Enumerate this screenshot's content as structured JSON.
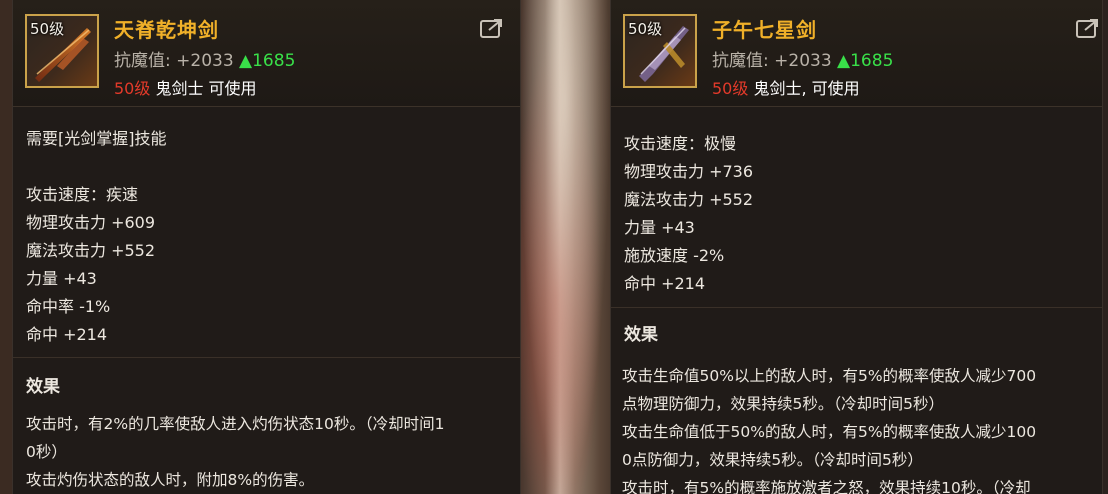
{
  "left": {
    "level_badge": "50级",
    "name": "天脊乾坤剑",
    "resist_label": "抗魔值: +2033",
    "resist_bonus": "▲1685",
    "req_level": "50级",
    "req_class": " 鬼剑士 可使用",
    "requirement": "需要[光剑掌握]技能",
    "stats": [
      "攻击速度：疾速",
      "物理攻击力 +609",
      "魔法攻击力 +552",
      "力量 +43",
      "命中率 -1%",
      "命中 +214"
    ],
    "effect_title": "效果",
    "effects": [
      "攻击时，有2%的几率使敌人进入灼伤状态10秒。（冷却时间1",
      "0秒）",
      "攻击灼伤状态的敌人时，附加8%的伤害。"
    ]
  },
  "right": {
    "level_badge": "50级",
    "name": "子午七星剑",
    "resist_label": "抗魔值: +2033",
    "resist_bonus": "▲1685",
    "req_level": "50级",
    "req_class": " 鬼剑士, 可使用",
    "stats": [
      "攻击速度：极慢",
      "物理攻击力 +736",
      "魔法攻击力 +552",
      "力量 +43",
      "施放速度 -2%",
      "命中 +214"
    ],
    "effect_title": "效果",
    "effects": [
      "攻击生命值50%以上的敌人时，有5%的概率使敌人减少700",
      "点物理防御力，效果持续5秒。（冷却时间5秒）",
      "攻击生命值低于50%的敌人时，有5%的概率使敌人减少100",
      "0点防御力，效果持续5秒。（冷却时间5秒）",
      "攻击时，有5%的概率施放激者之怒，效果持续10秒。（冷却"
    ]
  },
  "colors": {
    "title": "#f0b029",
    "bonus": "#39e049",
    "level_req": "#e33a2a",
    "icon_border": "#caa24a"
  },
  "icons": {
    "share": "share-icon",
    "weapon_left": "sword-icon",
    "weapon_right": "sword-icon"
  }
}
